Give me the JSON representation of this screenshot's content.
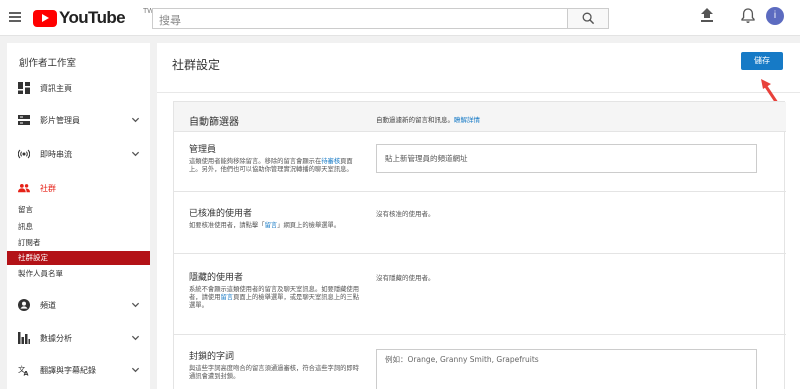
{
  "header": {
    "logo_text": "YouTube",
    "logo_region": "TW",
    "search_placeholder": "搜尋"
  },
  "sidebar": {
    "studio_title": "創作者工作室",
    "items": [
      {
        "label": "資訊主頁",
        "icon": "dashboard-icon"
      },
      {
        "label": "影片管理員",
        "icon": "video-manager-icon",
        "expandable": true
      },
      {
        "label": "即時串流",
        "icon": "live-stream-icon",
        "expandable": true
      },
      {
        "label": "社群",
        "icon": "community-icon",
        "active": true
      }
    ],
    "community_sub": [
      {
        "label": "留言"
      },
      {
        "label": "訊息"
      },
      {
        "label": "訂閱者"
      },
      {
        "label": "社群設定",
        "selected": true
      },
      {
        "label": "製作人員名單"
      }
    ],
    "bottom_items": [
      {
        "label": "頻道",
        "icon": "channel-icon",
        "expandable": true
      },
      {
        "label": "數據分析",
        "icon": "analytics-icon",
        "expandable": true
      },
      {
        "label": "翻譯與字幕紀錄",
        "icon": "translate-icon",
        "expandable": true
      }
    ]
  },
  "main": {
    "title": "社群設定",
    "save_label": "儲存",
    "panel": {
      "title": "自動篩選器",
      "description": "自動過濾新的留言和訊息。",
      "learn_more": "瞭解詳情"
    },
    "moderators": {
      "title": "管理員",
      "desc_1": "這類使用者能夠移除留言。移除的留言會顯示在",
      "desc_link": "待審核",
      "desc_2": "頁面上。另外，他們也可以協助你管理實況轉播的聊天室訊息。",
      "placeholder": "貼上新管理員的頻道網址"
    },
    "approved": {
      "title": "已核准的使用者",
      "desc_1": "如要核准使用者，請點擊「",
      "desc_link": "留言",
      "desc_2": "」網頁上的檢舉選單。",
      "empty": "沒有核准的使用者。"
    },
    "hidden": {
      "title": "隱藏的使用者",
      "desc_1": "系統不會顯示這類使用者的留言及聊天室訊息。如要隱藏使用者，請使用",
      "desc_link": "留言",
      "desc_2": "頁面上的檢舉選單，或是聊天室訊息上的三點選單。",
      "empty": "沒有隱藏的使用者。"
    },
    "blocked_words": {
      "title": "封鎖的字詞",
      "desc": "與這些字詞高度吻合的留言須通過審核，符合這些字詞的即時通訊會遭到封鎖。",
      "placeholder": "例如：Orange, Granny Smith, Grapefruits"
    }
  },
  "colors": {
    "brand_red": "#ff0000",
    "accent_blue": "#167ac6",
    "selected_red": "#b31217",
    "active_red": "#e62117"
  }
}
